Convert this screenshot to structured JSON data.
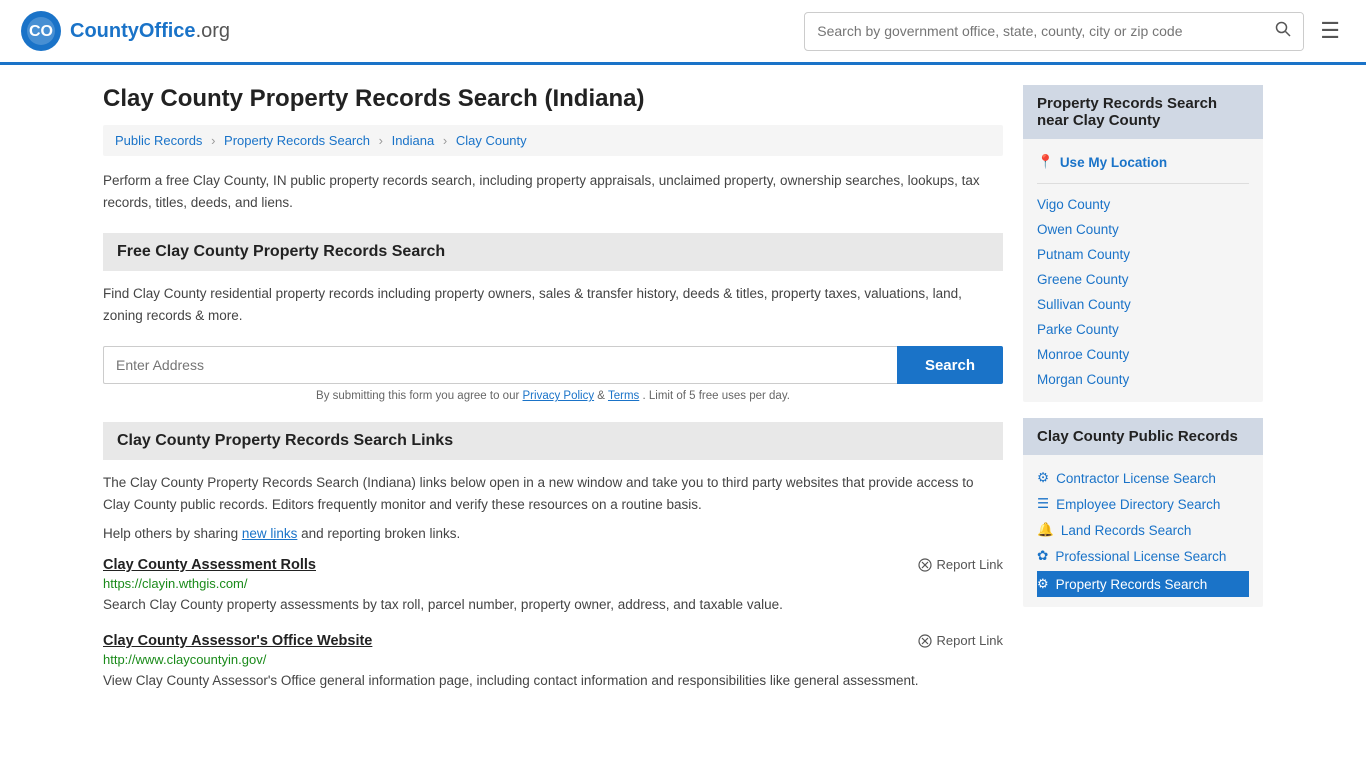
{
  "header": {
    "logo_text": "CountyOffice",
    "logo_suffix": ".org",
    "search_placeholder": "Search by government office, state, county, city or zip code",
    "menu_icon": "☰"
  },
  "page": {
    "title": "Clay County Property Records Search (Indiana)",
    "breadcrumb": [
      {
        "label": "Public Records",
        "href": "#"
      },
      {
        "label": "Property Records Search",
        "href": "#"
      },
      {
        "label": "Indiana",
        "href": "#"
      },
      {
        "label": "Clay County",
        "href": "#"
      }
    ],
    "description": "Perform a free Clay County, IN public property records search, including property appraisals, unclaimed property, ownership searches, lookups, tax records, titles, deeds, and liens.",
    "free_search_header": "Free Clay County Property Records Search",
    "free_search_desc": "Find Clay County residential property records including property owners, sales & transfer history, deeds & titles, property taxes, valuations, land, zoning records & more.",
    "address_placeholder": "Enter Address",
    "search_btn": "Search",
    "terms_text": "By submitting this form you agree to our",
    "privacy_link": "Privacy Policy",
    "terms_link": "Terms",
    "terms_suffix": ". Limit of 5 free uses per day.",
    "links_section_header": "Clay County Property Records Search Links",
    "links_description": "The Clay County Property Records Search (Indiana) links below open in a new window and take you to third party websites that provide access to Clay County public records. Editors frequently monitor and verify these resources on a routine basis.",
    "share_prefix": "Help others by sharing",
    "share_link_text": "new links",
    "share_suffix": "and reporting broken links.",
    "links": [
      {
        "title": "Clay County Assessment Rolls",
        "url": "https://clayin.wthgis.com/",
        "description": "Search Clay County property assessments by tax roll, parcel number, property owner, address, and taxable value.",
        "report_label": "Report Link"
      },
      {
        "title": "Clay County Assessor's Office Website",
        "url": "http://www.claycountyin.gov/",
        "description": "View Clay County Assessor's Office general information page, including contact information and responsibilities like general assessment.",
        "report_label": "Report Link"
      }
    ]
  },
  "sidebar": {
    "nearby_header": "Property Records Search near Clay County",
    "use_location_label": "Use My Location",
    "nearby_counties": [
      "Vigo County",
      "Owen County",
      "Putnam County",
      "Greene County",
      "Sullivan County",
      "Parke County",
      "Monroe County",
      "Morgan County"
    ],
    "public_records_header": "Clay County Public Records",
    "public_records_links": [
      {
        "icon": "⚙",
        "label": "Contractor License Search"
      },
      {
        "icon": "☰",
        "label": "Employee Directory Search"
      },
      {
        "icon": "🔔",
        "label": "Land Records Search"
      },
      {
        "icon": "✿",
        "label": "Professional License Search"
      },
      {
        "icon": "⚙",
        "label": "Property Records Search"
      }
    ]
  }
}
